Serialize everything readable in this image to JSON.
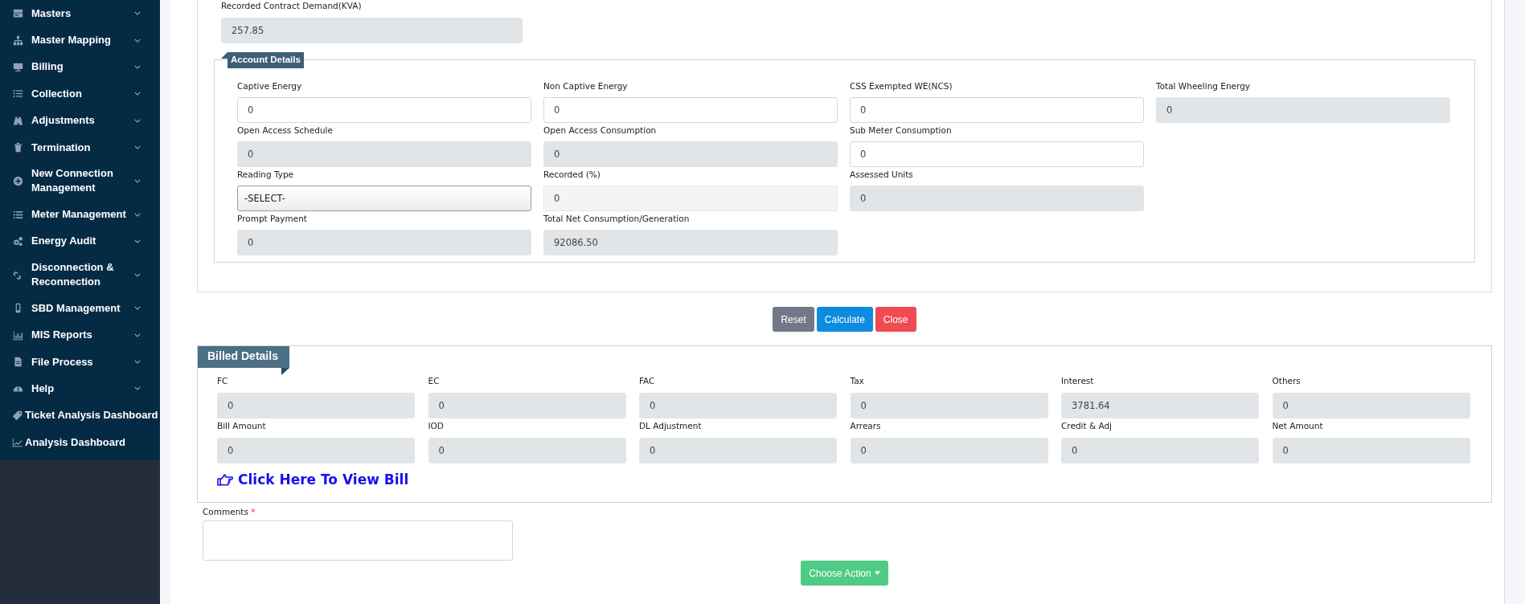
{
  "sidebar": {
    "items": [
      {
        "label": "Masters",
        "kind": "menu"
      },
      {
        "label": "Master Mapping",
        "kind": "menu"
      },
      {
        "label": "Billing",
        "kind": "menu"
      },
      {
        "label": "Collection",
        "kind": "menu"
      },
      {
        "label": "Adjustments",
        "kind": "menu"
      },
      {
        "label": "Termination",
        "kind": "menu"
      },
      {
        "label": "New Connection Management",
        "kind": "menu"
      },
      {
        "label": "Meter Management",
        "kind": "menu"
      },
      {
        "label": "Energy Audit",
        "kind": "menu"
      },
      {
        "label": "Disconnection & Reconnection",
        "kind": "menu"
      },
      {
        "label": "SBD Management",
        "kind": "menu"
      },
      {
        "label": "MIS Reports",
        "kind": "menu"
      },
      {
        "label": "File Process",
        "kind": "menu"
      },
      {
        "label": "Help",
        "kind": "menu"
      },
      {
        "label": "Ticket Analysis Dashboard",
        "kind": "link"
      },
      {
        "label": "Analysis Dashboard",
        "kind": "link"
      }
    ]
  },
  "contract_demand": {
    "label": "Recorded Contract Demand(KVA)",
    "value": "257.85"
  },
  "account_details": {
    "title": "Account Details",
    "rows": [
      [
        {
          "label": "Captive Energy",
          "value": "0",
          "kind": "input"
        },
        {
          "label": "Non Captive Energy",
          "value": "0",
          "kind": "input"
        },
        {
          "label": "CSS Exempted WE(NCS)",
          "value": "0",
          "kind": "input"
        },
        {
          "label": "Total Wheeling Energy",
          "value": "0",
          "kind": "readonly"
        }
      ],
      [
        {
          "label": "Open Access Schedule",
          "value": "0",
          "kind": "readonly"
        },
        {
          "label": "Open Access Consumption",
          "value": "0",
          "kind": "readonly"
        },
        {
          "label": "Sub Meter Consumption",
          "value": "0",
          "kind": "input"
        }
      ],
      [
        {
          "label": "Reading Type",
          "value": "-SELECT-",
          "kind": "select"
        },
        {
          "label": "Recorded (%)",
          "value": "0",
          "kind": "disabled"
        },
        {
          "label": "Assessed Units",
          "value": "0",
          "kind": "readonly"
        }
      ],
      [
        {
          "label": "Prompt Payment",
          "value": "0",
          "kind": "readonly"
        },
        {
          "label": "Total Net Consumption/Generation",
          "value": "92086.50",
          "kind": "readonly"
        }
      ]
    ]
  },
  "actions": [
    {
      "label": "Reset",
      "kind": "secondary"
    },
    {
      "label": "Calculate",
      "kind": "primary"
    },
    {
      "label": "Close",
      "kind": "danger"
    }
  ],
  "billed_details": {
    "title": "Billed Details",
    "fields": [
      {
        "label": "FC",
        "value": "0"
      },
      {
        "label": "EC",
        "value": "0"
      },
      {
        "label": "FAC",
        "value": "0"
      },
      {
        "label": "Tax",
        "value": "0"
      },
      {
        "label": "Interest",
        "value": "3781.64"
      },
      {
        "label": "Others",
        "value": "0"
      },
      {
        "label": "Bill Amount",
        "value": "0"
      },
      {
        "label": "IOD",
        "value": "0"
      },
      {
        "label": "DL Adjustment",
        "value": "0"
      },
      {
        "label": "Arrears",
        "value": "0"
      },
      {
        "label": "Credit & Adj",
        "value": "0"
      },
      {
        "label": "Net Amount",
        "value": "0"
      }
    ],
    "link": "Click Here To View Bill"
  },
  "comments": {
    "label": "Comments",
    "required_mark": "*"
  },
  "choose_action": {
    "label": "Choose Action"
  }
}
